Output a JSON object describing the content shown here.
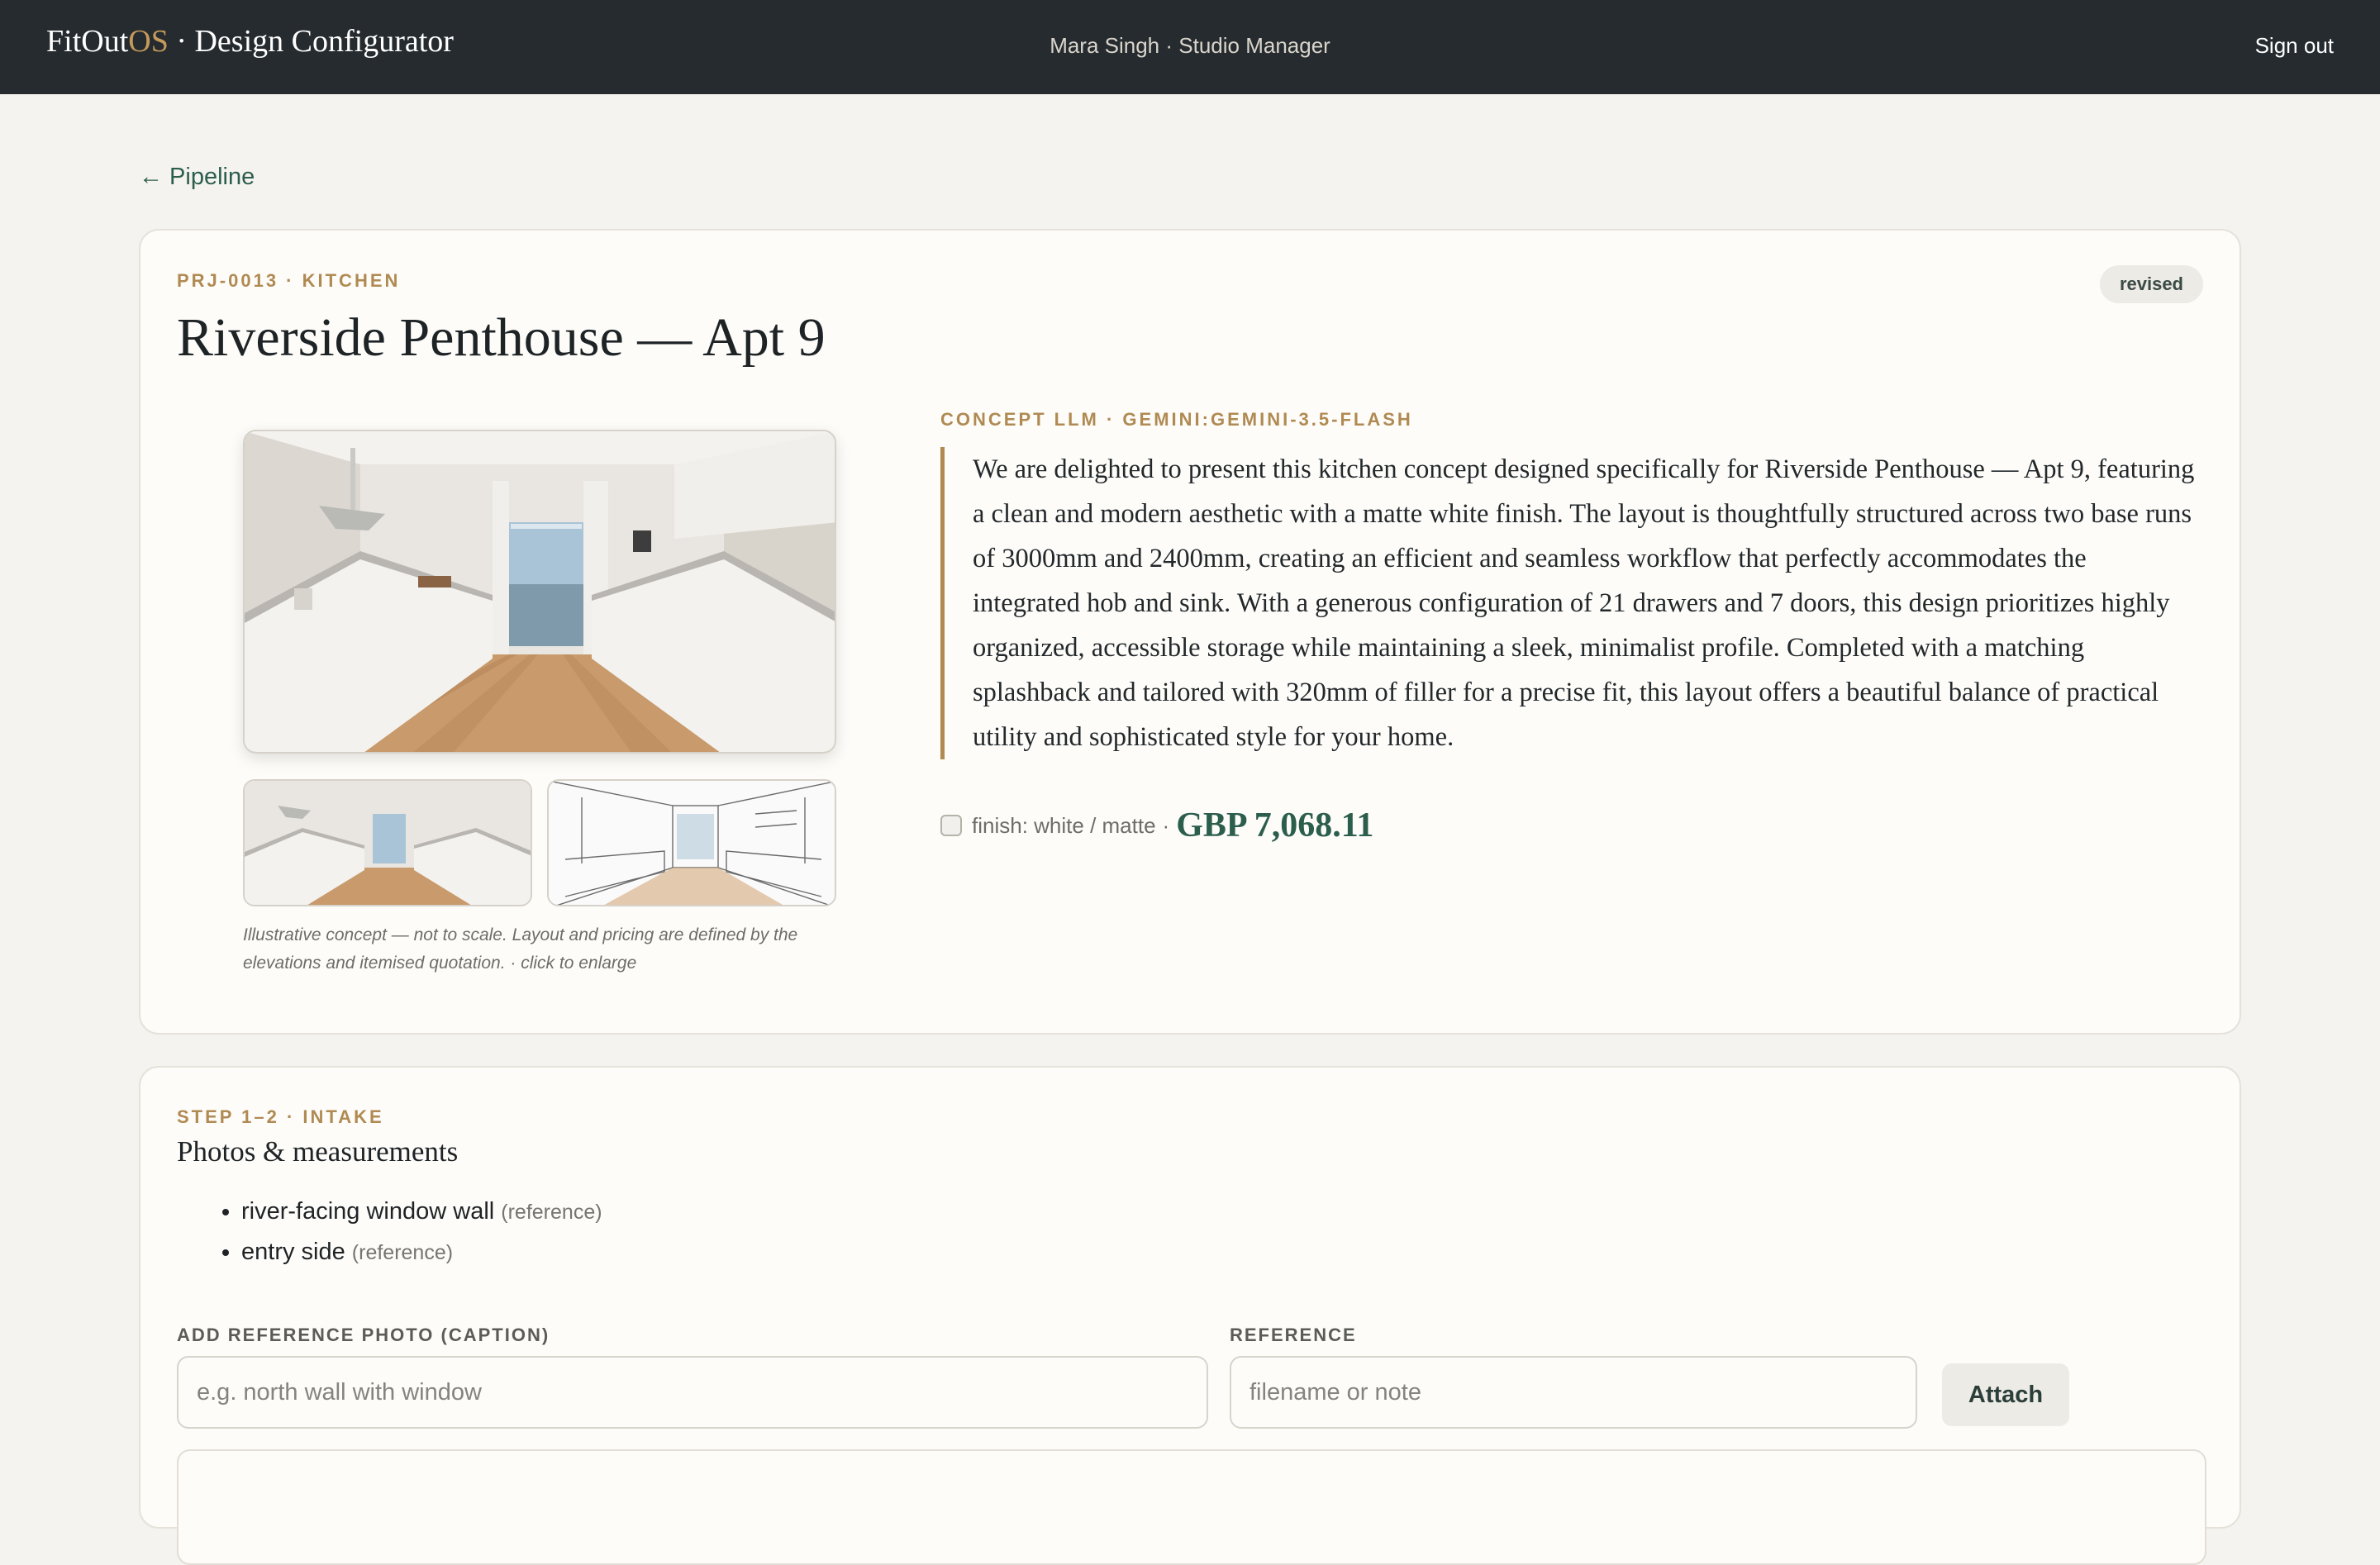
{
  "header": {
    "brand_prefix": "FitOut",
    "brand_accent": "OS",
    "brand_suffix": " · Design Configurator",
    "user": "Mara Singh · Studio Manager",
    "signout_label": "Sign out"
  },
  "nav": {
    "back_label": "← Pipeline"
  },
  "project": {
    "code": "PRJ-0013 · KITCHEN",
    "title": "Riverside Penthouse — Apt 9",
    "status": "revised"
  },
  "concept": {
    "image_caption": "Illustrative concept — not to scale. Layout and pricing are defined by the elevations and itemised quotation. · click to enlarge",
    "llm_label": "CONCEPT LLM · GEMINI:GEMINI-3.5-FLASH",
    "text": "We are delighted to present this kitchen concept designed specifically for Riverside Penthouse — Apt 9, featuring a clean and modern aesthetic with a matte white finish. The layout is thoughtfully structured across two base runs of 3000mm and 2400mm, creating an efficient and seamless workflow that perfectly accommodates the integrated hob and sink. With a generous configuration of 21 drawers and 7 doors, this design prioritizes highly organized, accessible storage while maintaining a sleek, minimalist profile. Completed with a matching splashback and tailored with 320mm of filler for a precise fit, this layout offers a beautiful balance of practical utility and sophisticated style for your home.",
    "finish": "finish: white / matte",
    "separator": "·",
    "price": "GBP 7,068.11",
    "finish_checked": false
  },
  "intake": {
    "step_label": "STEP 1–2 · INTAKE",
    "title": "Photos & measurements",
    "photos": [
      {
        "name": "river-facing window wall",
        "tag": "(reference)"
      },
      {
        "name": "entry side",
        "tag": "(reference)"
      }
    ],
    "caption_label": "ADD REFERENCE PHOTO (CAPTION)",
    "caption_placeholder": "e.g. north wall with window",
    "reference_label": "REFERENCE",
    "reference_placeholder": "filename or note",
    "attach_label": "Attach"
  },
  "colors": {
    "topbar": "#262b2f",
    "accent_gold": "#b08a52",
    "accent_green": "#2c5e4e",
    "background": "#f5f3ef"
  }
}
